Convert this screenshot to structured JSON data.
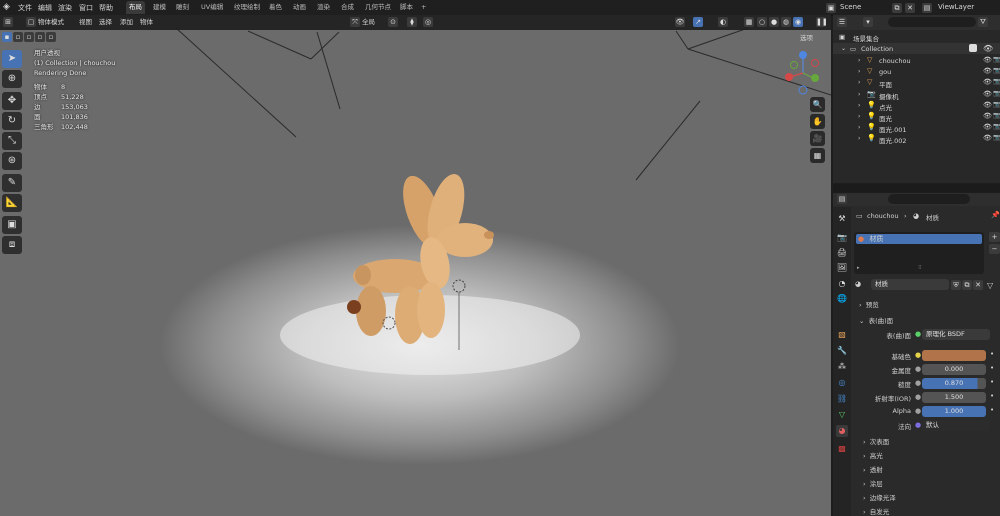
{
  "menu": {
    "items": [
      "文件",
      "编辑",
      "渲染",
      "窗口",
      "帮助"
    ]
  },
  "workspace_tabs": [
    "布局",
    "建模",
    "雕刻",
    "UV编辑",
    "纹理绘制",
    "着色",
    "动画",
    "渲染",
    "合成",
    "几何节点",
    "脚本",
    "+"
  ],
  "scene": {
    "name": "Scene",
    "view_layer": "ViewLayer"
  },
  "viewport": {
    "mode": "物体模式",
    "menus": [
      "视图",
      "选择",
      "添加",
      "物体"
    ],
    "transform": "全局",
    "options_label": "选项",
    "info": {
      "view": "用户透视",
      "collection": "(1) Collection | chouchou",
      "status": "Rendering Done"
    },
    "stats": [
      {
        "k": "物体",
        "v": "8"
      },
      {
        "k": "顶点",
        "v": "51,228"
      },
      {
        "k": "边",
        "v": "153,063"
      },
      {
        "k": "面",
        "v": "101,836"
      },
      {
        "k": "三角形",
        "v": "102,448"
      }
    ]
  },
  "outliner": {
    "search_placeholder": "",
    "root": "场景集合",
    "collection": "Collection",
    "items": [
      {
        "name": "chouchou",
        "icon": "mesh",
        "color": "#e8a55a"
      },
      {
        "name": "gou",
        "icon": "mesh",
        "color": "#e8a55a"
      },
      {
        "name": "平面",
        "icon": "mesh",
        "color": "#e8a55a"
      },
      {
        "name": "摄像机",
        "icon": "camera",
        "color": "#e8a55a"
      },
      {
        "name": "点光",
        "icon": "light",
        "color": "#e8a55a"
      },
      {
        "name": "面光",
        "icon": "light",
        "color": "#e8a55a"
      },
      {
        "name": "面光.001",
        "icon": "light",
        "color": "#e8a55a"
      },
      {
        "name": "面光.002",
        "icon": "light",
        "color": "#e8a55a"
      }
    ]
  },
  "properties": {
    "breadcrumb_object": "chouchou",
    "breadcrumb_material": "材质",
    "slot": "材质",
    "material_name": "材质",
    "section_preview": "预览",
    "section_surface": "表(曲)面",
    "surface_label": "表(曲)面",
    "surface_value": "原理化 BSDF",
    "base_color_label": "基础色",
    "base_color": "#b0734a",
    "metallic_label": "金属度",
    "metallic_value": "0.000",
    "roughness_label": "糙度",
    "roughness_value": "0.870",
    "ior_label": "折射率(IOR)",
    "ior_value": "1.500",
    "alpha_label": "Alpha",
    "alpha_value": "1.000",
    "normal_label": "法向",
    "normal_value": "默认",
    "subsections": [
      "次表面",
      "高光",
      "透射",
      "涂层",
      "边缘光泽",
      "自发光"
    ]
  }
}
